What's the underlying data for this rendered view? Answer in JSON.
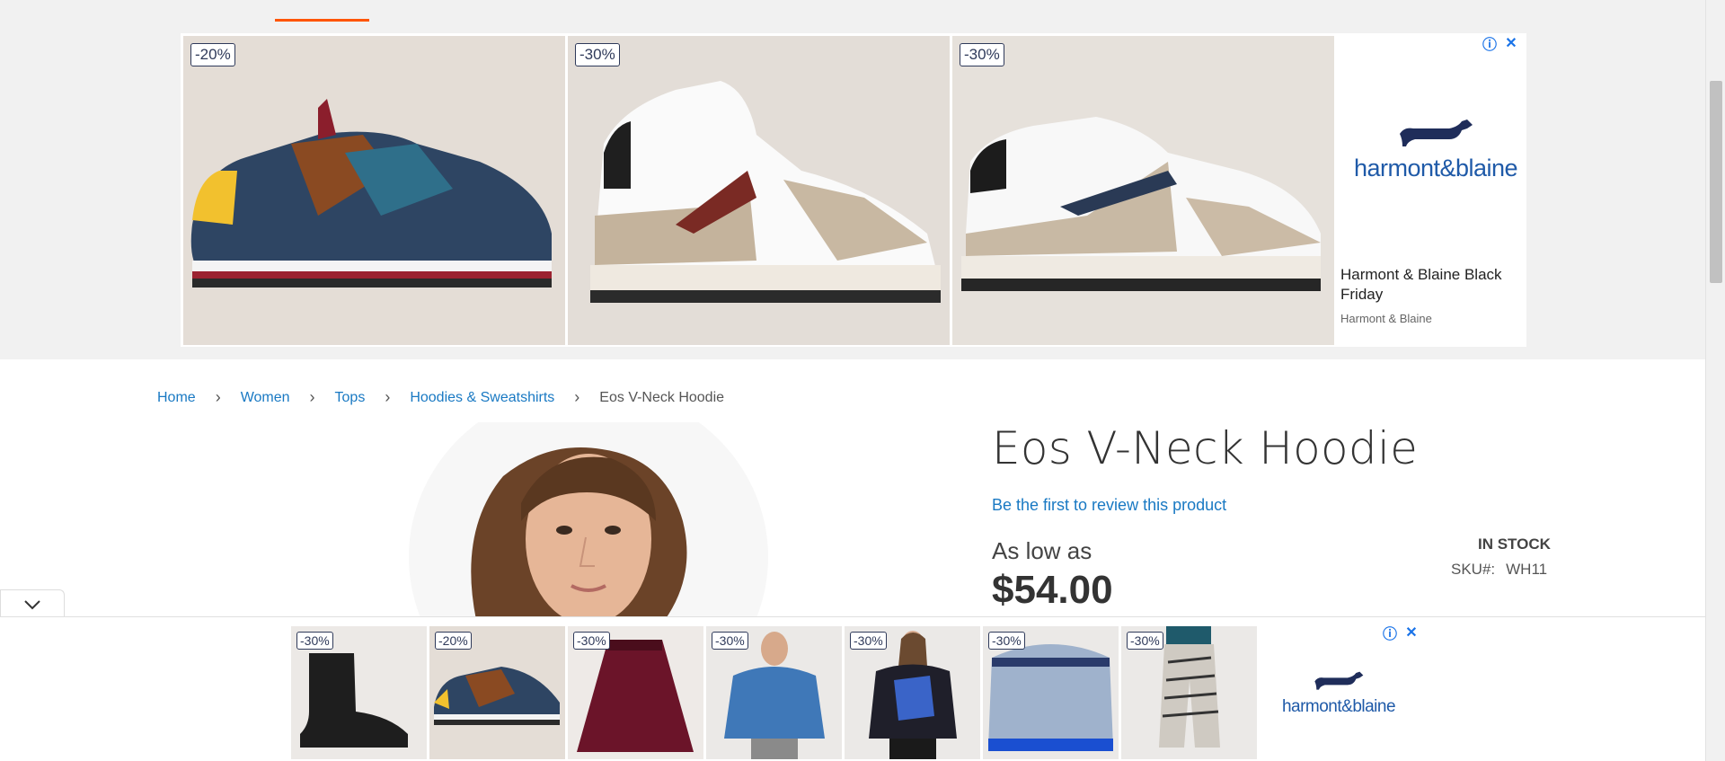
{
  "top_ad": {
    "tiles": [
      {
        "discount": "-20%",
        "image": "blue-brown-sneaker"
      },
      {
        "discount": "-30%",
        "image": "white-beige-high-top-sneaker"
      },
      {
        "discount": "-30%",
        "image": "white-beige-low-sneaker"
      }
    ],
    "brand_logo": "harmont&blaine",
    "ad_title": "Harmont & Blaine Black Friday",
    "ad_subtitle": "Harmont & Blaine",
    "ad_choices_icon": "info-icon",
    "close_icon": "close-icon"
  },
  "breadcrumb": {
    "items": [
      {
        "label": "Home"
      },
      {
        "label": "Women"
      },
      {
        "label": "Tops"
      },
      {
        "label": "Hoodies & Sweatshirts"
      }
    ],
    "current": "Eos V-Neck Hoodie"
  },
  "product": {
    "title": "Eos V-Neck Hoodie",
    "review_link": "Be the first to review this product",
    "price_prefix": "As low as",
    "price": "$54.00",
    "stock": "IN STOCK",
    "sku_label": "SKU#:",
    "sku": "WH11"
  },
  "bottom_ad": {
    "tiles": [
      {
        "discount": "-30%",
        "image": "black-chelsea-boot"
      },
      {
        "discount": "-20%",
        "image": "blue-brown-sneaker"
      },
      {
        "discount": "-30%",
        "image": "burgundy-tulle-skirt"
      },
      {
        "discount": "-30%",
        "image": "man-blue-sweater"
      },
      {
        "discount": "-30%",
        "image": "woman-blue-pattern-sweater"
      },
      {
        "discount": "-30%",
        "image": "blue-white-knit-sweater"
      },
      {
        "discount": "-30%",
        "image": "patterned-trousers"
      }
    ],
    "brand_logo": "harmont&blaine",
    "collapse_icon": "chevron-down-icon"
  },
  "colors": {
    "accent": "#ff5501",
    "link": "#1979c3",
    "brand_blue": "#1f5aa8"
  }
}
